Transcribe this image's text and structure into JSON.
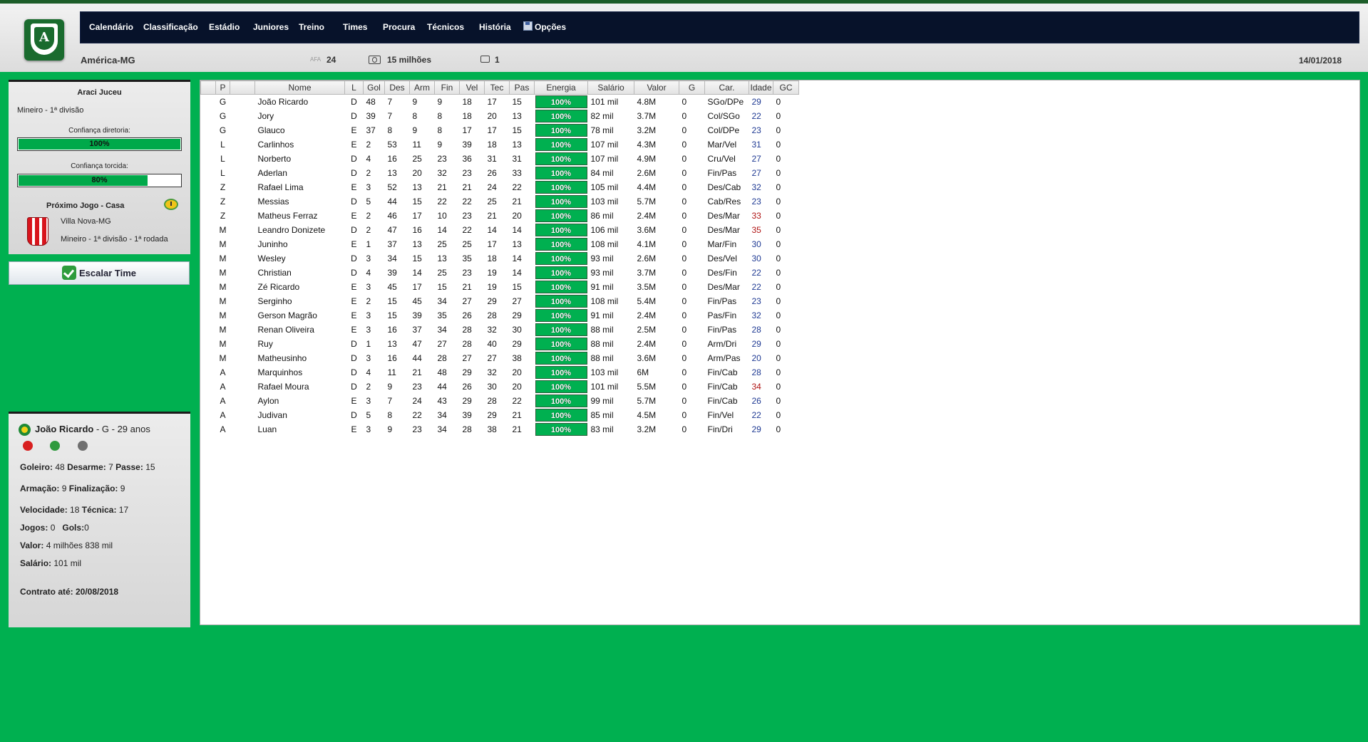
{
  "header": {
    "team": "América-MG",
    "logo_letter": "A",
    "stat_a_label": "AFA",
    "stat_a_value": "24",
    "money": "15 milhões",
    "messages": "1",
    "date": "14/01/2018"
  },
  "nav": [
    "Calendário",
    "Classificação",
    "Estádio",
    "Juniores",
    "Treino",
    "Times",
    "Procura",
    "Técnicos",
    "História",
    "Opções"
  ],
  "coach": {
    "name": "Araci Juceu",
    "division": "Mineiro - 1ª divisão",
    "conf_board_label": "Confiança diretoria:",
    "conf_board_value": "100%",
    "conf_board_level": 1.0,
    "conf_fans_label": "Confiança torcida:",
    "conf_fans_value": "80%",
    "conf_fans_level": 0.8,
    "next_game_title": "Próximo Jogo - Casa",
    "opponent": "Villa Nova-MG",
    "opponent_info": "Mineiro - 1ª divisão - 1ª rodada"
  },
  "escalar_label": "Escalar Time",
  "player": {
    "name": "João Ricardo",
    "pos_age": " - G - 29 anos",
    "line1": [
      {
        "k": "Goleiro:",
        "v": "48"
      },
      {
        "k": "Desarme:",
        "v": "7"
      },
      {
        "k": "Passe:",
        "v": "15"
      }
    ],
    "line2": [
      {
        "k": "Armação:",
        "v": "9"
      },
      {
        "k": "Finalização:",
        "v": "9"
      }
    ],
    "line3": [
      {
        "k": "Velocidade:",
        "v": "18"
      },
      {
        "k": "Técnica:",
        "v": "17"
      }
    ],
    "line4": [
      {
        "k": "Jogos:",
        "v": "0"
      },
      {
        "k": "Gols:",
        "v": "0"
      }
    ],
    "valor_label": "Valor:",
    "valor": "4 milhões 838 mil",
    "salario_label": "Salário:",
    "salario": "101 mil",
    "contract": "Contrato até: 20/08/2018"
  },
  "table": {
    "columns": [
      "",
      "P",
      "",
      "Nome",
      "L",
      "Gol",
      "Des",
      "Arm",
      "Fin",
      "Vel",
      "Tec",
      "Pas",
      "Energia",
      "Salário",
      "Valor",
      "G",
      "Car.",
      "Idade",
      "GC"
    ],
    "rows": [
      [
        "G",
        "João Ricardo",
        "D",
        "48",
        "7",
        "9",
        "9",
        "18",
        "17",
        "15",
        "100%",
        "101 mil",
        "4.8M",
        "0",
        "SGo/DPe",
        "29",
        "0"
      ],
      [
        "G",
        "Jory",
        "D",
        "39",
        "7",
        "8",
        "8",
        "18",
        "20",
        "13",
        "100%",
        "82 mil",
        "3.7M",
        "0",
        "Col/SGo",
        "22",
        "0"
      ],
      [
        "G",
        "Glauco",
        "E",
        "37",
        "8",
        "9",
        "8",
        "17",
        "17",
        "15",
        "100%",
        "78 mil",
        "3.2M",
        "0",
        "Col/DPe",
        "23",
        "0"
      ],
      [
        "L",
        "Carlinhos",
        "E",
        "2",
        "53",
        "11",
        "9",
        "39",
        "18",
        "13",
        "100%",
        "107 mil",
        "4.3M",
        "0",
        "Mar/Vel",
        "31",
        "0"
      ],
      [
        "L",
        "Norberto",
        "D",
        "4",
        "16",
        "25",
        "23",
        "36",
        "31",
        "31",
        "100%",
        "107 mil",
        "4.9M",
        "0",
        "Cru/Vel",
        "27",
        "0"
      ],
      [
        "L",
        "Aderlan",
        "D",
        "2",
        "13",
        "20",
        "32",
        "23",
        "26",
        "33",
        "100%",
        "84 mil",
        "2.6M",
        "0",
        "Fin/Pas",
        "27",
        "0"
      ],
      [
        "Z",
        "Rafael Lima",
        "E",
        "3",
        "52",
        "13",
        "21",
        "21",
        "24",
        "22",
        "100%",
        "105 mil",
        "4.4M",
        "0",
        "Des/Cab",
        "32",
        "0"
      ],
      [
        "Z",
        "Messias",
        "D",
        "5",
        "44",
        "15",
        "22",
        "22",
        "25",
        "21",
        "100%",
        "103 mil",
        "5.7M",
        "0",
        "Cab/Res",
        "23",
        "0"
      ],
      [
        "Z",
        "Matheus Ferraz",
        "E",
        "2",
        "46",
        "17",
        "10",
        "23",
        "21",
        "20",
        "100%",
        "86 mil",
        "2.4M",
        "0",
        "Des/Mar",
        "33",
        "0"
      ],
      [
        "M",
        "Leandro Donizete",
        "D",
        "2",
        "47",
        "16",
        "14",
        "22",
        "14",
        "14",
        "100%",
        "106 mil",
        "3.6M",
        "0",
        "Des/Mar",
        "35",
        "0"
      ],
      [
        "M",
        "Juninho",
        "E",
        "1",
        "37",
        "13",
        "25",
        "25",
        "17",
        "13",
        "100%",
        "108 mil",
        "4.1M",
        "0",
        "Mar/Fin",
        "30",
        "0"
      ],
      [
        "M",
        "Wesley",
        "D",
        "3",
        "34",
        "15",
        "13",
        "35",
        "18",
        "14",
        "100%",
        "93 mil",
        "2.6M",
        "0",
        "Des/Vel",
        "30",
        "0"
      ],
      [
        "M",
        "Christian",
        "D",
        "4",
        "39",
        "14",
        "25",
        "23",
        "19",
        "14",
        "100%",
        "93 mil",
        "3.7M",
        "0",
        "Des/Fin",
        "22",
        "0"
      ],
      [
        "M",
        "Zé Ricardo",
        "E",
        "3",
        "45",
        "17",
        "15",
        "21",
        "19",
        "15",
        "100%",
        "91 mil",
        "3.5M",
        "0",
        "Des/Mar",
        "22",
        "0"
      ],
      [
        "M",
        "Serginho",
        "E",
        "2",
        "15",
        "45",
        "34",
        "27",
        "29",
        "27",
        "100%",
        "108 mil",
        "5.4M",
        "0",
        "Fin/Pas",
        "23",
        "0"
      ],
      [
        "M",
        "Gerson Magrão",
        "E",
        "3",
        "15",
        "39",
        "35",
        "26",
        "28",
        "29",
        "100%",
        "91 mil",
        "2.4M",
        "0",
        "Pas/Fin",
        "32",
        "0"
      ],
      [
        "M",
        "Renan Oliveira",
        "E",
        "3",
        "16",
        "37",
        "34",
        "28",
        "32",
        "30",
        "100%",
        "88 mil",
        "2.5M",
        "0",
        "Fin/Pas",
        "28",
        "0"
      ],
      [
        "M",
        "Ruy",
        "D",
        "1",
        "13",
        "47",
        "27",
        "28",
        "40",
        "29",
        "100%",
        "88 mil",
        "2.4M",
        "0",
        "Arm/Dri",
        "29",
        "0"
      ],
      [
        "M",
        "Matheusinho",
        "D",
        "3",
        "16",
        "44",
        "28",
        "27",
        "27",
        "38",
        "100%",
        "88 mil",
        "3.6M",
        "0",
        "Arm/Pas",
        "20",
        "0"
      ],
      [
        "A",
        "Marquinhos",
        "D",
        "4",
        "11",
        "21",
        "48",
        "29",
        "32",
        "20",
        "100%",
        "103 mil",
        "6M",
        "0",
        "Fin/Cab",
        "28",
        "0"
      ],
      [
        "A",
        "Rafael Moura",
        "D",
        "2",
        "9",
        "23",
        "44",
        "26",
        "30",
        "20",
        "100%",
        "101 mil",
        "5.5M",
        "0",
        "Fin/Cab",
        "34",
        "0"
      ],
      [
        "A",
        "Aylon",
        "E",
        "3",
        "7",
        "24",
        "43",
        "29",
        "28",
        "22",
        "100%",
        "99 mil",
        "5.7M",
        "0",
        "Fin/Cab",
        "26",
        "0"
      ],
      [
        "A",
        "Judivan",
        "D",
        "5",
        "8",
        "22",
        "34",
        "39",
        "29",
        "21",
        "100%",
        "85 mil",
        "4.5M",
        "0",
        "Fin/Vel",
        "22",
        "0"
      ],
      [
        "A",
        "Luan",
        "E",
        "3",
        "9",
        "23",
        "34",
        "28",
        "38",
        "21",
        "100%",
        "83 mil",
        "3.2M",
        "0",
        "Fin/Dri",
        "29",
        "0"
      ]
    ]
  }
}
